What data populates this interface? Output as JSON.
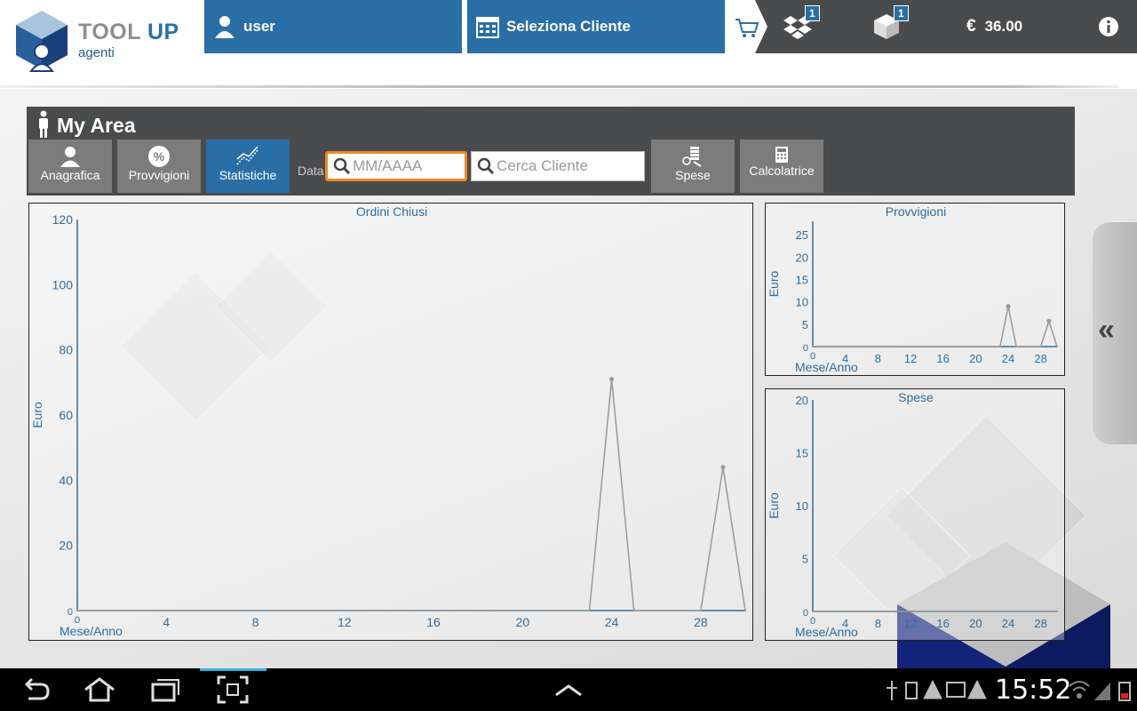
{
  "app": {
    "brand_main": "TOOL ",
    "brand_accent": "UP",
    "brand_sub": "agenti"
  },
  "header": {
    "user_label": "user",
    "client_label": "Seleziona Cliente",
    "box_badge": "1",
    "package_badge": "1",
    "currency": "€",
    "amount": "36.00"
  },
  "myarea": {
    "title": "My Area",
    "tabs": [
      {
        "label": "Anagrafica",
        "icon": "person-icon"
      },
      {
        "label": "Provvigioni",
        "icon": "percent-icon"
      },
      {
        "label": "Statistiche",
        "icon": "chart-line-icon",
        "active": true
      },
      {
        "label": "Spese",
        "icon": "coins-icon"
      },
      {
        "label": "Calcolatrice",
        "icon": "calculator-icon"
      }
    ],
    "data_label": "Data",
    "date_placeholder": "MM/AAAA",
    "client_placeholder": "Cerca Cliente"
  },
  "charts": {
    "colors": {
      "axis": "#2e6da0",
      "line": "#999999"
    }
  },
  "chart_data": [
    {
      "type": "line",
      "title": "Ordini Chiusi",
      "xlabel": "Mese/Anno",
      "ylabel": "Euro",
      "xlim": [
        0,
        30
      ],
      "ylim": [
        0,
        120
      ],
      "xticks": [
        0,
        4,
        8,
        12,
        16,
        20,
        24,
        28
      ],
      "yticks": [
        0,
        20,
        40,
        60,
        80,
        100,
        120
      ],
      "x": [
        0,
        1,
        2,
        3,
        4,
        5,
        6,
        7,
        8,
        9,
        10,
        11,
        12,
        13,
        14,
        15,
        16,
        17,
        18,
        19,
        20,
        21,
        22,
        23,
        24,
        25,
        26,
        27,
        28,
        29,
        30
      ],
      "values": [
        0,
        0,
        0,
        0,
        0,
        0,
        0,
        0,
        0,
        0,
        0,
        0,
        0,
        0,
        0,
        0,
        0,
        0,
        0,
        0,
        0,
        0,
        0,
        0,
        71,
        0,
        0,
        0,
        0,
        44,
        0
      ]
    },
    {
      "type": "line",
      "title": "Provvigioni",
      "xlabel": "Mese/Anno",
      "ylabel": "Euro",
      "xlim": [
        0,
        30
      ],
      "ylim": [
        0,
        28
      ],
      "xticks": [
        0,
        4,
        8,
        12,
        16,
        20,
        24,
        28
      ],
      "yticks": [
        0,
        5,
        10,
        15,
        20,
        25
      ],
      "x": [
        0,
        1,
        2,
        3,
        4,
        5,
        6,
        7,
        8,
        9,
        10,
        11,
        12,
        13,
        14,
        15,
        16,
        17,
        18,
        19,
        20,
        21,
        22,
        23,
        24,
        25,
        26,
        27,
        28,
        29,
        30
      ],
      "values": [
        0,
        0,
        0,
        0,
        0,
        0,
        0,
        0,
        0,
        0,
        0,
        0,
        0,
        0,
        0,
        0,
        0,
        0,
        0,
        0,
        0,
        0,
        0,
        0,
        9,
        0,
        0,
        0,
        0,
        5.7,
        0
      ]
    },
    {
      "type": "line",
      "title": "Spese",
      "xlabel": "Mese/Anno",
      "ylabel": "Euro",
      "xlim": [
        0,
        30
      ],
      "ylim": [
        0,
        20
      ],
      "xticks": [
        0,
        4,
        8,
        12,
        16,
        20,
        24,
        28
      ],
      "yticks": [
        0,
        5,
        10,
        15,
        20
      ],
      "x": [
        0,
        1,
        2,
        3,
        4,
        5,
        6,
        7,
        8,
        9,
        10,
        11,
        12,
        13,
        14,
        15,
        16,
        17,
        18,
        19,
        20,
        21,
        22,
        23,
        24,
        25,
        26,
        27,
        28,
        29,
        30
      ],
      "values": [
        0,
        0,
        0,
        0,
        0,
        0,
        0,
        0,
        0,
        0,
        0,
        0,
        0,
        0,
        0,
        0,
        0,
        0,
        0,
        0,
        0,
        0,
        0,
        0,
        0,
        0,
        0,
        0,
        0,
        0,
        0
      ]
    }
  ],
  "statusbar": {
    "time": "15:52"
  }
}
